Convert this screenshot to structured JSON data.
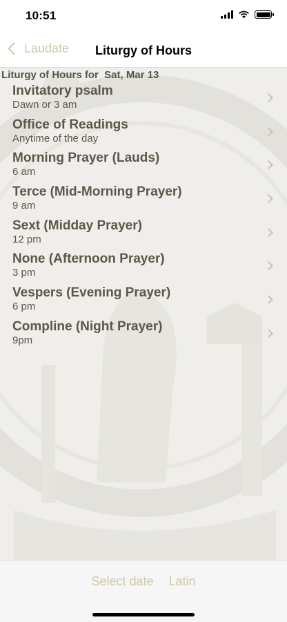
{
  "status_bar": {
    "time": "10:51"
  },
  "nav": {
    "back_label": "Laudate",
    "title": "Liturgy of Hours"
  },
  "content": {
    "header": "Liturgy of Hours for  Sat, Mar 13",
    "items": [
      {
        "title": "Invitatory psalm",
        "time": "Dawn or 3 am"
      },
      {
        "title": "Office of Readings",
        "time": "Anytime of the day"
      },
      {
        "title": "Morning Prayer (Lauds)",
        "time": "6 am"
      },
      {
        "title": "Terce (Mid-Morning Prayer)",
        "time": "9 am"
      },
      {
        "title": "Sext (Midday Prayer)",
        "time": "12 pm"
      },
      {
        "title": "None (Afternoon Prayer)",
        "time": "3 pm"
      },
      {
        "title": "Vespers (Evening Prayer)",
        "time": "6 pm"
      },
      {
        "title": "Compline (Night Prayer)",
        "time": "9pm"
      }
    ]
  },
  "toolbar": {
    "select_date_label": "Select date",
    "latin_label": "Latin"
  },
  "colors": {
    "accent": "#cfc7a6",
    "text": "#5a5849",
    "content_bg": "#efeeea"
  },
  "icons": {
    "back": "chevron-left-icon",
    "row": "chevron-right-icon",
    "wifi": "wifi-icon",
    "signal": "signal-icon",
    "battery": "battery-icon"
  }
}
